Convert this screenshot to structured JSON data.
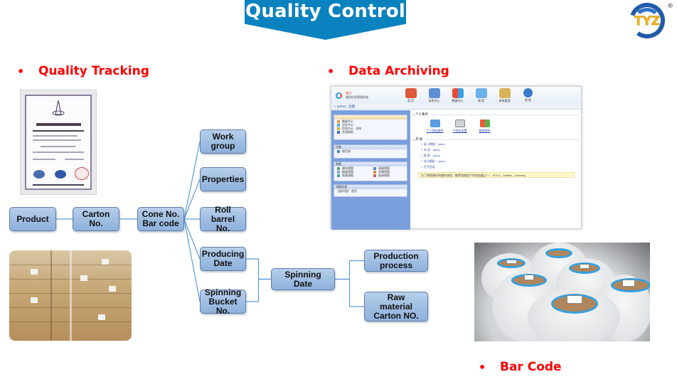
{
  "header": {
    "title": "Quality Control",
    "logo_text": "TYZ",
    "logo_mark": "®",
    "banner_color": "#0a82c0"
  },
  "sections": {
    "quality_tracking": {
      "bullet": "•",
      "label": "Quality Tracking"
    },
    "data_archiving": {
      "bullet": "•",
      "label": "Data Archiving"
    },
    "bar_code": {
      "bullet": "•",
      "label": "Bar Code"
    },
    "heading_color": "#ff0000"
  },
  "images": {
    "certificate": "management-system-certificate",
    "cartons": "stacked-carton-boxes-photo",
    "spools": "yarn-spools-with-barcodes-photo"
  },
  "software": {
    "logo_line1": "盛点",
    "logo_line2": "通用信息管理系统",
    "toolbar": [
      {
        "icon": "home-icon",
        "label": "首 页",
        "color": "#e0573a"
      },
      {
        "icon": "info-center-icon",
        "label": "信息中心",
        "color": "#5b8fd0"
      },
      {
        "icon": "data-center-icon",
        "label": "数据中心",
        "color": "#e9b43a"
      },
      {
        "icon": "search-icon",
        "label": "搜 索",
        "color": "#6cb0e8"
      },
      {
        "icon": "system-admin-icon",
        "label": "系统管理",
        "color": "#d7b25a"
      },
      {
        "icon": "help-icon",
        "label": "帮 助",
        "color": "#3a7ad0"
      }
    ],
    "breadcrumb": "« admin - 注销",
    "sidebar": {
      "nav_items": [
        "数据中心",
        "设计中心",
        "信息中心 - 发布",
        "在线帮助"
      ],
      "catalog_title": "目录",
      "catalog_items": [
        "根目录"
      ],
      "views_title": "视图",
      "views_items": [
        "模块视图",
        "表格视图",
        "概要视图",
        "详情视图",
        "图表视图",
        "报表视图"
      ],
      "details_title": "详细信息",
      "details_items": [
        "当前内容：首页"
      ]
    },
    "main": {
      "personal_title": "个人事务",
      "personal_items": [
        "个人资料维护",
        "个性化设置",
        "修改密码"
      ],
      "start_title": "开 始",
      "start_items": [
        "录入数据：query",
        "浏 览：query",
        "搜 索：query",
        "设计模板：query",
        "打开目录"
      ],
      "notice": "为了获得更好的操作体验，推荐您使用下列浏览器之一： IE 9.0、Firefox、Chrome。"
    }
  },
  "diagram": {
    "nodes": {
      "product": "Product",
      "carton": "Carton\nNo.",
      "cone": "Cone No.\nBar code",
      "work_group": "Work\ngroup",
      "properties": "Properties",
      "roll_barrel": "Roll barrel\nNo.",
      "producing_date": "Producing\nDate",
      "spinning_bucket": "Spinning\nBucket No.",
      "spinning_date": "Spinning\nDate",
      "production_process": "Production\nprocess",
      "raw_material": "Raw\nmaterial\nCarton NO."
    },
    "edges": [
      [
        "product",
        "carton"
      ],
      [
        "carton",
        "cone"
      ],
      [
        "cone",
        "work_group"
      ],
      [
        "cone",
        "properties"
      ],
      [
        "cone",
        "roll_barrel"
      ],
      [
        "cone",
        "producing_date"
      ],
      [
        "cone",
        "spinning_bucket"
      ],
      [
        "producing_date",
        "spinning_date"
      ],
      [
        "spinning_bucket",
        "spinning_date"
      ],
      [
        "spinning_date",
        "production_process"
      ],
      [
        "spinning_date",
        "raw_material"
      ]
    ],
    "link_color": "#5b9bd5"
  }
}
